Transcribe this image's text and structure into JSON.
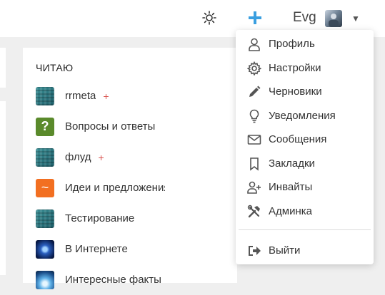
{
  "header": {
    "username": "Evg",
    "caret": "▼"
  },
  "reading": {
    "title": "ЧИТАЮ",
    "items": [
      {
        "name": "rrmeta",
        "plus": "+",
        "icon": "texture-avatar"
      },
      {
        "name": "Вопросы и ответы",
        "plus": "",
        "icon": "question-avatar",
        "glyph": "?"
      },
      {
        "name": "флуд",
        "plus": "+",
        "icon": "texture-avatar"
      },
      {
        "name": "Идеи и предложения",
        "plus": "",
        "icon": "tilde-avatar",
        "glyph": "~"
      },
      {
        "name": "Тестирование",
        "plus": "",
        "icon": "texture-avatar"
      },
      {
        "name": "В Интернете",
        "plus": "",
        "icon": "web-avatar"
      },
      {
        "name": "Интересные факты",
        "plus": "",
        "icon": "facts-avatar"
      }
    ]
  },
  "menu": {
    "items": [
      {
        "label": "Профиль",
        "icon": "user-icon"
      },
      {
        "label": "Настройки",
        "icon": "gear-icon"
      },
      {
        "label": "Черновики",
        "icon": "pencil-icon"
      },
      {
        "label": "Уведомления",
        "icon": "lightbulb-icon"
      },
      {
        "label": "Сообщения",
        "icon": "envelope-icon"
      },
      {
        "label": "Закладки",
        "icon": "bookmark-icon"
      },
      {
        "label": "Инвайты",
        "icon": "user-plus-icon"
      },
      {
        "label": "Админка",
        "icon": "tools-icon"
      }
    ],
    "logout": {
      "label": "Выйти",
      "icon": "sign-out-icon"
    }
  },
  "colors": {
    "accent_plus": "#3a9fe0",
    "badge_plus": "#d9534f",
    "icon_gray": "#555555"
  }
}
